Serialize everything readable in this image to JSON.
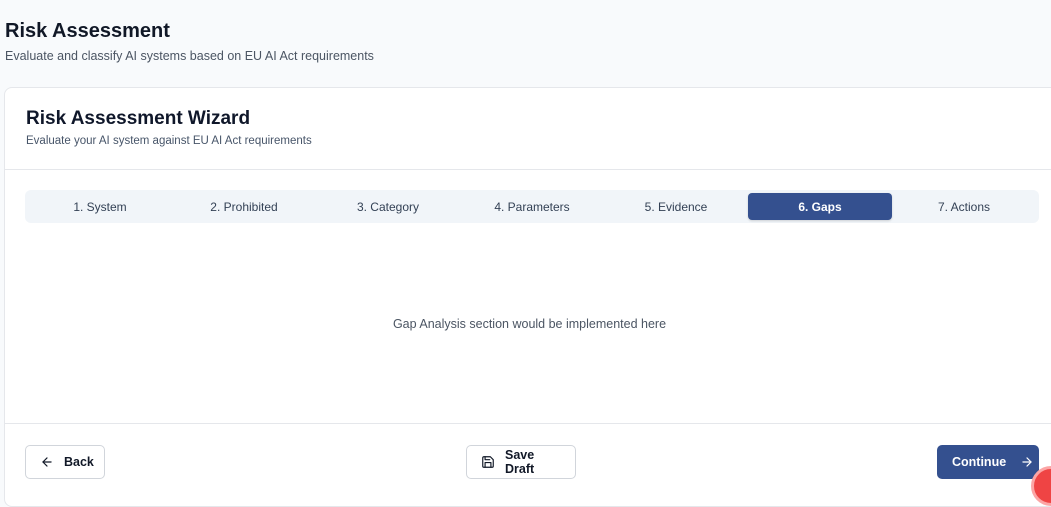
{
  "page": {
    "title": "Risk Assessment",
    "subtitle": "Evaluate and classify AI systems based on EU AI Act requirements"
  },
  "wizard": {
    "title": "Risk Assessment Wizard",
    "subtitle": "Evaluate your AI system against EU AI Act requirements",
    "steps": [
      {
        "label": "1. System"
      },
      {
        "label": "2. Prohibited"
      },
      {
        "label": "3. Category"
      },
      {
        "label": "4. Parameters"
      },
      {
        "label": "5. Evidence"
      },
      {
        "label": "6. Gaps",
        "active": true
      },
      {
        "label": "7. Actions"
      }
    ],
    "content_placeholder": "Gap Analysis section would be implemented here"
  },
  "footer": {
    "back_label": "Back",
    "save_label": "Save Draft",
    "continue_label": "Continue"
  },
  "colors": {
    "primary": "#34508f",
    "background": "#f8fafc",
    "step_track": "#f1f5f9"
  },
  "icons": {
    "back": "arrow-left-icon",
    "save": "save-icon",
    "continue": "arrow-right-icon"
  }
}
